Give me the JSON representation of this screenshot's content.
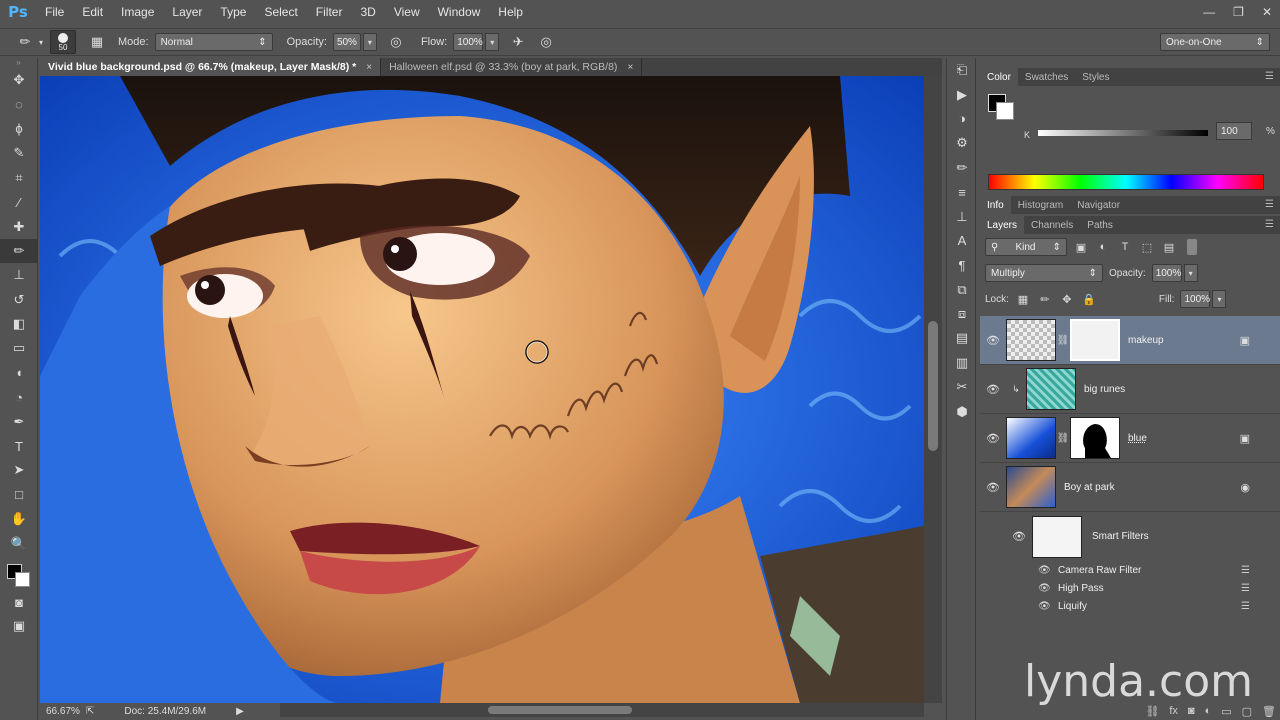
{
  "app": {
    "logo": "Ps",
    "menu": [
      "File",
      "Edit",
      "Image",
      "Layer",
      "Type",
      "Select",
      "Filter",
      "3D",
      "View",
      "Window",
      "Help"
    ],
    "window_controls": [
      "—",
      "❐",
      "✕"
    ]
  },
  "options_bar": {
    "brush_size": "50",
    "mode_label": "Mode:",
    "mode_value": "Normal",
    "opacity_label": "Opacity:",
    "opacity_value": "50%",
    "flow_label": "Flow:",
    "flow_value": "100%",
    "workspace": "One-on-One"
  },
  "tools": [
    "move-tool",
    "marquee-tool",
    "lasso-tool",
    "quick-select-tool",
    "crop-tool",
    "eyedropper-tool",
    "healing-brush-tool",
    "brush-tool",
    "clone-stamp-tool",
    "history-brush-tool",
    "eraser-tool",
    "gradient-tool",
    "blur-tool",
    "dodge-tool",
    "pen-tool",
    "type-tool",
    "path-select-tool",
    "rectangle-tool",
    "hand-tool",
    "zoom-tool"
  ],
  "tool_glyphs": [
    "✥",
    "◌",
    "ϕ",
    "✎",
    "⌗",
    "⁄",
    "✚",
    "✏",
    "⊥",
    "↺",
    "◧",
    "▭",
    "◖",
    "◔",
    "✒",
    "T",
    "➤",
    "□",
    "✋",
    "🔍"
  ],
  "documents": {
    "active_tab": "Vivid blue background.psd @ 66.7% (makeup, Layer Mask/8) *",
    "other_tab": "Halloween elf.psd @ 33.3% (boy at park, RGB/8)",
    "close": "×"
  },
  "status": {
    "zoom": "66.67%",
    "doc_info": "Doc: 25.4M/29.6M"
  },
  "color_panel": {
    "tabs": [
      "Color",
      "Swatches",
      "Styles"
    ],
    "channel": "K",
    "value": "100",
    "unit": "%"
  },
  "info_panel": {
    "tabs": [
      "Info",
      "Histogram",
      "Navigator"
    ]
  },
  "layers_panel": {
    "tabs": [
      "Layers",
      "Channels",
      "Paths"
    ],
    "kind": "Kind",
    "blend_mode": "Multiply",
    "opacity_label": "Opacity:",
    "opacity_value": "100%",
    "lock_label": "Lock:",
    "fill_label": "Fill:",
    "fill_value": "100%",
    "layers": [
      {
        "name": "makeup"
      },
      {
        "name": "big runes"
      },
      {
        "name": "blue"
      },
      {
        "name": "Boy at park"
      }
    ],
    "smart_filters_label": "Smart Filters",
    "filters": [
      "Camera Raw Filter",
      "High Pass",
      "Liquify"
    ]
  },
  "watermark": "lynda.com"
}
